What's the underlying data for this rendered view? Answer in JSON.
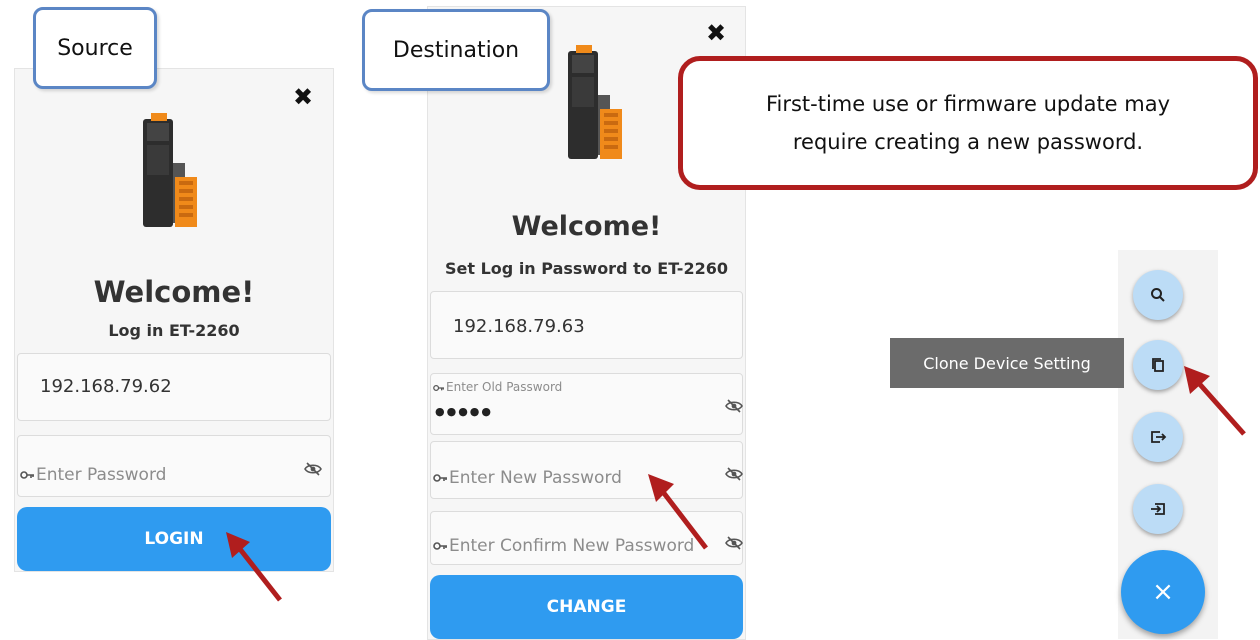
{
  "source": {
    "tag": "Source",
    "welcome": "Welcome!",
    "subtitle": "Log in ET-2260",
    "ip": "192.168.79.62",
    "password_placeholder": "Enter Password",
    "button": "LOGIN"
  },
  "destination": {
    "tag": "Destination",
    "welcome": "Welcome!",
    "subtitle": "Set Log in Password to ET-2260",
    "ip": "192.168.79.63",
    "old_password_label": "Enter Old Password",
    "old_password_mask": "●●●●●",
    "new_password_placeholder": "Enter New Password",
    "confirm_password_placeholder": "Enter Confirm New Password",
    "button": "CHANGE"
  },
  "note": {
    "line1": "First-time use or firmware update may",
    "line2": "require creating a new password."
  },
  "fab_menu": {
    "tooltip": "Clone Device Setting",
    "icons": [
      "search-icon",
      "copy-icon",
      "export-icon",
      "import-icon",
      "close-icon"
    ],
    "close_glyph": "×"
  },
  "colors": {
    "accent_blue": "#2f9bf0",
    "fab_light": "#bcdcf6",
    "callout_red": "#b01e1e",
    "tag_border": "#5b86c5"
  }
}
